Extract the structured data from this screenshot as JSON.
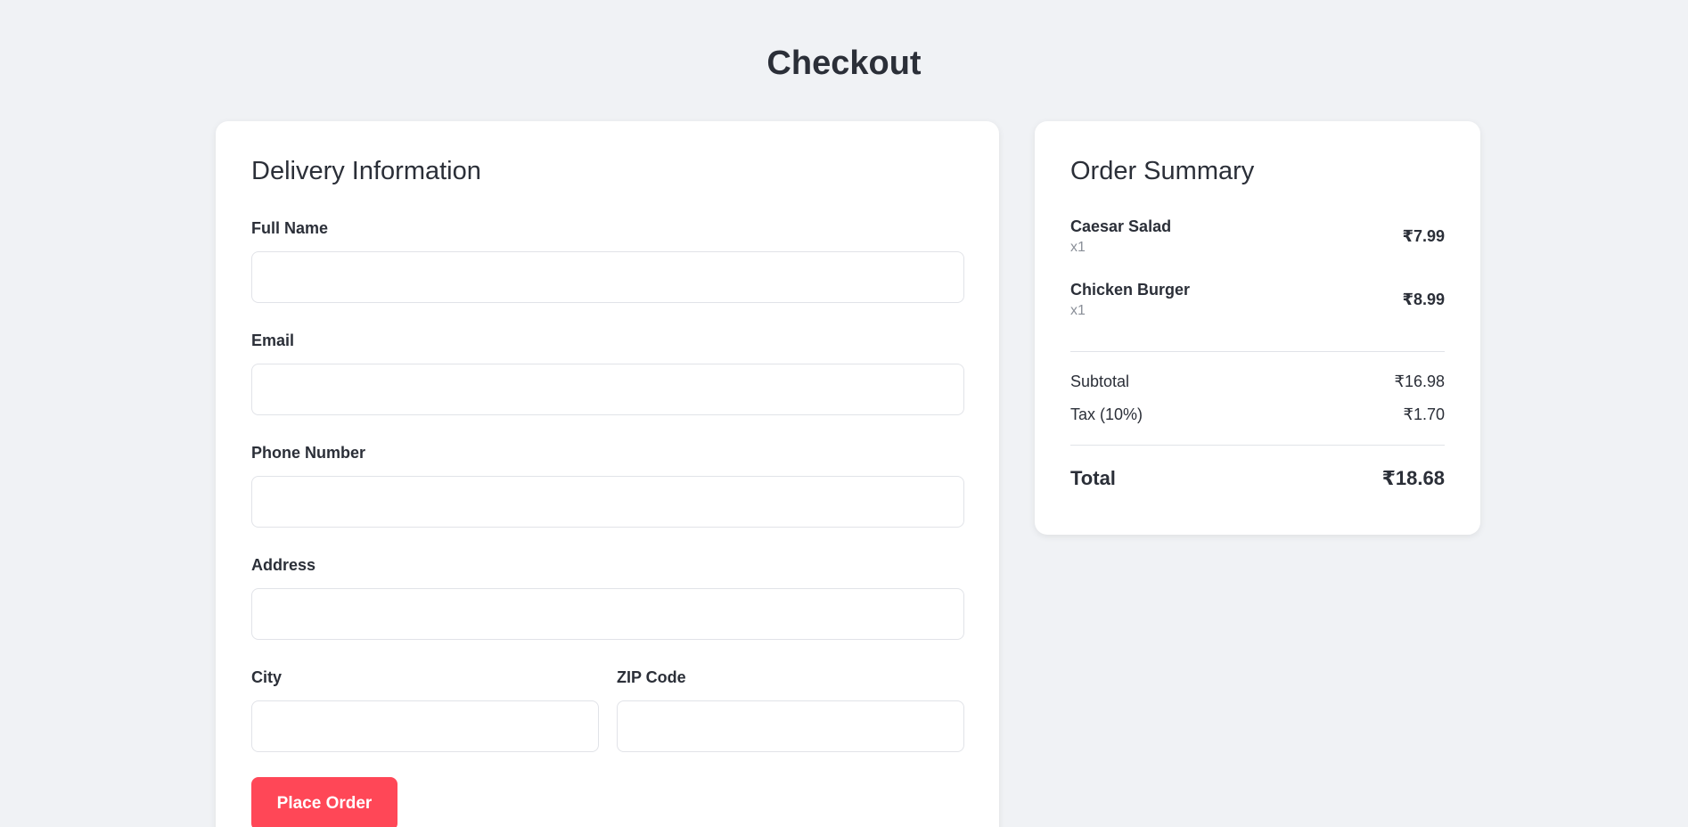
{
  "page_title": "Checkout",
  "delivery": {
    "heading": "Delivery Information",
    "fields": [
      {
        "label": "Full Name",
        "value": ""
      },
      {
        "label": "Email",
        "value": ""
      },
      {
        "label": "Phone Number",
        "value": ""
      },
      {
        "label": "Address",
        "value": ""
      },
      {
        "label": "City",
        "value": ""
      },
      {
        "label": "ZIP Code",
        "value": ""
      }
    ],
    "submit_label": "Place Order",
    "accent": "#ff4757"
  },
  "summary": {
    "heading": "Order Summary",
    "items": [
      {
        "name": "Caesar Salad",
        "qty": "x1",
        "price": "₹7.99"
      },
      {
        "name": "Chicken Burger",
        "qty": "x1",
        "price": "₹8.99"
      }
    ],
    "subtotal_label": "Subtotal",
    "subtotal": "₹16.98",
    "tax_label": "Tax (10%)",
    "tax": "₹1.70",
    "total_label": "Total",
    "total": "₹18.68"
  }
}
